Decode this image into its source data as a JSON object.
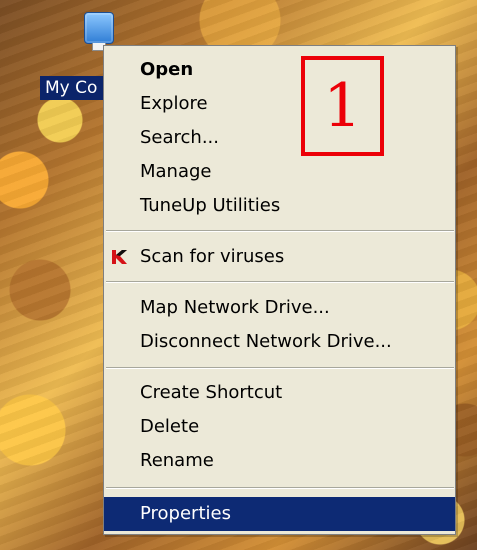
{
  "desktop": {
    "icon_label": "My Co",
    "icon_name": "computer-icon"
  },
  "context_menu": {
    "items": [
      {
        "label": "Open",
        "style": "bold",
        "icon": ""
      },
      {
        "label": "Explore",
        "icon": ""
      },
      {
        "label": "Search...",
        "icon": ""
      },
      {
        "label": "Manage",
        "icon": ""
      },
      {
        "label": "TuneUp Utilities",
        "icon": ""
      },
      {
        "label": "Scan for viruses",
        "icon": "antivirus-k-icon"
      },
      {
        "label": "Map Network Drive...",
        "icon": ""
      },
      {
        "label": "Disconnect Network Drive...",
        "icon": ""
      },
      {
        "label": "Create Shortcut",
        "icon": ""
      },
      {
        "label": "Delete",
        "icon": ""
      },
      {
        "label": "Rename",
        "icon": ""
      },
      {
        "label": "Properties",
        "selected": true,
        "icon": ""
      }
    ]
  },
  "annotation": {
    "step_number": "1",
    "color": "#ec0008"
  },
  "colors": {
    "menu_background": "#ece9d8",
    "selection_background": "#0d2a74",
    "desktop_label_background": "#0b246a"
  }
}
